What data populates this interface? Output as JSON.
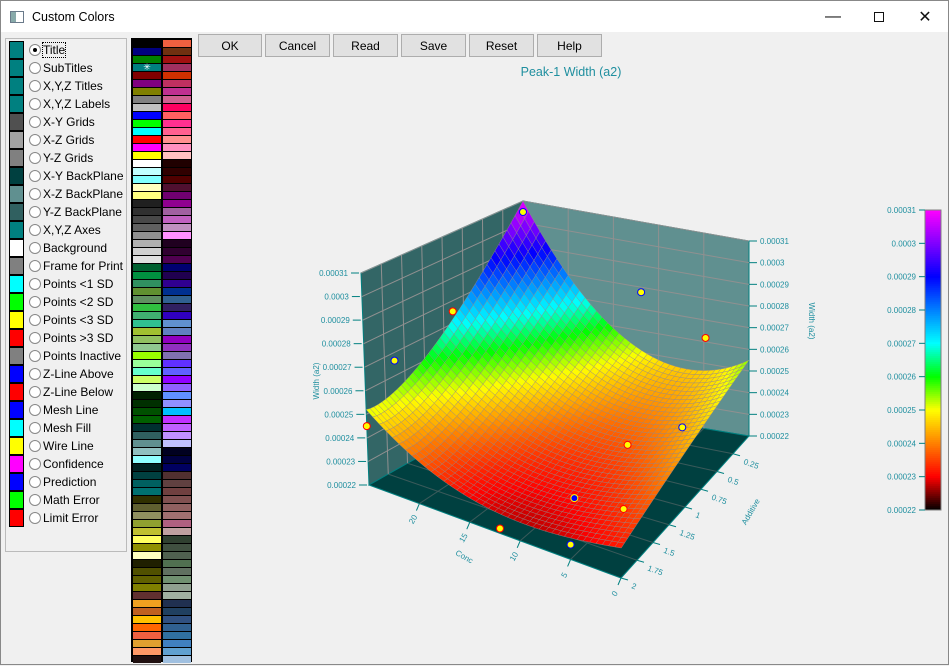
{
  "window": {
    "title": "Custom Colors",
    "minimize_icon": "minimize-icon",
    "maximize_icon": "maximize-icon",
    "close_icon": "close-icon"
  },
  "items": [
    {
      "label": "Title",
      "color": "#008080",
      "selected": true
    },
    {
      "label": "SubTitles",
      "color": "#008080"
    },
    {
      "label": "X,Y,Z Titles",
      "color": "#008080"
    },
    {
      "label": "X,Y,Z Labels",
      "color": "#008080"
    },
    {
      "label": "X-Y Grids",
      "color": "#505050"
    },
    {
      "label": "X-Z Grids",
      "color": "#a0a0a0"
    },
    {
      "label": "Y-Z Grids",
      "color": "#808080"
    },
    {
      "label": "X-Y BackPlane",
      "color": "#004040"
    },
    {
      "label": "X-Z BackPlane",
      "color": "#609090"
    },
    {
      "label": "Y-Z BackPlane",
      "color": "#306060"
    },
    {
      "label": "X,Y,Z Axes",
      "color": "#008080"
    },
    {
      "label": "Background",
      "color": "#ffffff"
    },
    {
      "label": "Frame for Print",
      "color": "#808080"
    },
    {
      "label": "Points <1 SD",
      "color": "#00ffff"
    },
    {
      "label": "Points <2 SD",
      "color": "#00ff00"
    },
    {
      "label": "Points <3 SD",
      "color": "#ffff00"
    },
    {
      "label": "Points >3 SD",
      "color": "#ff0000"
    },
    {
      "label": "Points Inactive",
      "color": "#808080"
    },
    {
      "label": "Z-Line Above",
      "color": "#0000ff"
    },
    {
      "label": "Z-Line Below",
      "color": "#ff0000"
    },
    {
      "label": "Mesh Line",
      "color": "#0000ff"
    },
    {
      "label": "Mesh Fill",
      "color": "#00ffff"
    },
    {
      "label": "Wire Line",
      "color": "#ffff00"
    },
    {
      "label": "Confidence",
      "color": "#ff00ff"
    },
    {
      "label": "Prediction",
      "color": "#0000ff"
    },
    {
      "label": "Math Error",
      "color": "#00ff00"
    },
    {
      "label": "Limit Error",
      "color": "#ff0000"
    }
  ],
  "palette": {
    "selected_marker": "✳",
    "col1": [
      "#000000",
      "#000080",
      "#008000",
      "#008080",
      "#800000",
      "#800080",
      "#808000",
      "#808080",
      "#c0c0c0",
      "#0000ff",
      "#00ff00",
      "#00ffff",
      "#ff0000",
      "#ff00ff",
      "#ffff00",
      "#ffffff",
      "#c0ffff",
      "#80ffff",
      "#ffffc0",
      "#ffff80",
      "#202020",
      "#303030",
      "#484848",
      "#606060",
      "#909090",
      "#b0b0b0",
      "#d0d0d0",
      "#e0e0e0",
      "#006030",
      "#009040",
      "#309060",
      "#609030",
      "#609060",
      "#30c040",
      "#40b070",
      "#30c090",
      "#a0c030",
      "#90c060",
      "#90c890",
      "#99ff00",
      "#99ff99",
      "#66ffcc",
      "#ccff66",
      "#ccffcc",
      "#002000",
      "#003000",
      "#005000",
      "#006000",
      "#003030",
      "#306060",
      "#609090",
      "#90c0c0",
      "#90ffff",
      "#002020",
      "#004040",
      "#006060",
      "#007070",
      "#303000",
      "#606030",
      "#909060",
      "#90a030",
      "#c0c030",
      "#ffff60",
      "#909000",
      "#ffffc0",
      "#202000",
      "#505000",
      "#606000",
      "#808000",
      "#603030",
      "#f0a020",
      "#c06020",
      "#ffc000",
      "#ff6600",
      "#f06040",
      "#e0a030",
      "#ff9966",
      "#201010"
    ],
    "col2": [
      "#f06040",
      "#703010",
      "#a01010",
      "#a03060",
      "#d03000",
      "#c03060",
      "#c03090",
      "#d06090",
      "#ff0060",
      "#ff6060",
      "#ff3090",
      "#ff6090",
      "#ff9090",
      "#ff90c0",
      "#ffc0c0",
      "#200000",
      "#300000",
      "#500000",
      "#501030",
      "#700070",
      "#900090",
      "#a060a0",
      "#c060c0",
      "#c090c0",
      "#ff90ff",
      "#200020",
      "#300030",
      "#500050",
      "#000070",
      "#200050",
      "#300090",
      "#003090",
      "#306090",
      "#302060",
      "#3000c0",
      "#6090d0",
      "#6080c0",
      "#9000c0",
      "#9030c0",
      "#8070b0",
      "#6030ff",
      "#6060ff",
      "#9000ff",
      "#9060ff",
      "#6090ff",
      "#9090ff",
      "#00c0ff",
      "#c030ff",
      "#c060ff",
      "#c090ff",
      "#c0c0ff",
      "#000020",
      "#000040",
      "#000060",
      "#503030",
      "#604040",
      "#704040",
      "#805050",
      "#906060",
      "#a07070",
      "#b06080",
      "#c0a0a0",
      "#304030",
      "#405040",
      "#506050",
      "#507050",
      "#607060",
      "#709070",
      "#90a090",
      "#a0b0a0",
      "#203050",
      "#204060",
      "#305080",
      "#306090",
      "#3070a0",
      "#4080c0",
      "#60a0d0",
      "#a0c0e0"
    ]
  },
  "buttons": {
    "ok": "OK",
    "cancel": "Cancel",
    "read": "Read",
    "save": "Save",
    "reset": "Reset",
    "help": "Help"
  },
  "chart": {
    "title": "Peak-1 Width (a2)",
    "z_label": "Width (a2)",
    "x_label": "Conc",
    "y_label": "Additive",
    "z_ticks": [
      "0.00022",
      "0.00023",
      "0.00024",
      "0.00025",
      "0.00026",
      "0.00027",
      "0.00028",
      "0.00029",
      "0.0003",
      "0.00031"
    ],
    "x_ticks": [
      "0",
      "5",
      "10",
      "15",
      "20"
    ],
    "y_ticks": [
      "2",
      "1.75",
      "1.5",
      "1.25",
      "1",
      "0.75",
      "0.5",
      "0.25"
    ],
    "z_range": [
      0.00022,
      0.00031
    ],
    "x_range": [
      0,
      25
    ],
    "y_range": [
      0,
      2
    ],
    "colormap": [
      "#000000",
      "#ff0000",
      "#ff8000",
      "#ffff00",
      "#00ff00",
      "#00ffff",
      "#0080ff",
      "#0000ff",
      "#8000ff",
      "#ff00ff"
    ],
    "points": [
      {
        "conc": 25,
        "additive": 0,
        "width": 0.000305,
        "fill": "#ffff00",
        "edge": "#0000ff"
      },
      {
        "conc": 25,
        "additive": 2,
        "width": 0.000245,
        "fill": "#ffff00",
        "edge": "#ff0000"
      },
      {
        "conc": 22,
        "additive": 1.25,
        "width": 0.000285,
        "fill": "#ffff00",
        "edge": "#ff0000"
      },
      {
        "conc": 24,
        "additive": 1.75,
        "width": 0.00027,
        "fill": "#ffff00",
        "edge": "#0000ff"
      },
      {
        "conc": 10,
        "additive": 0.25,
        "width": 0.000285,
        "fill": "#ffff00",
        "edge": "#0000ff"
      },
      {
        "conc": 3,
        "additive": 0.25,
        "width": 0.00027,
        "fill": "#ffff00",
        "edge": "#ff0000"
      },
      {
        "conc": 6,
        "additive": 1,
        "width": 0.00024,
        "fill": "#ffff00",
        "edge": "#ff0000"
      },
      {
        "conc": 2,
        "additive": 0.75,
        "width": 0.000245,
        "fill": "#ffff00",
        "edge": "#0000ff"
      },
      {
        "conc": 8,
        "additive": 1.5,
        "width": 0.000228,
        "fill": "#0000ff",
        "edge": "#ffff00"
      },
      {
        "conc": 3,
        "additive": 1.5,
        "width": 0.00023,
        "fill": "#ffff00",
        "edge": "#ff0000"
      },
      {
        "conc": 12,
        "additive": 2,
        "width": 0.000222,
        "fill": "#ffff00",
        "edge": "#ff0000"
      },
      {
        "conc": 5,
        "additive": 2,
        "width": 0.000226,
        "fill": "#ffff00",
        "edge": "#0000ff"
      }
    ]
  }
}
